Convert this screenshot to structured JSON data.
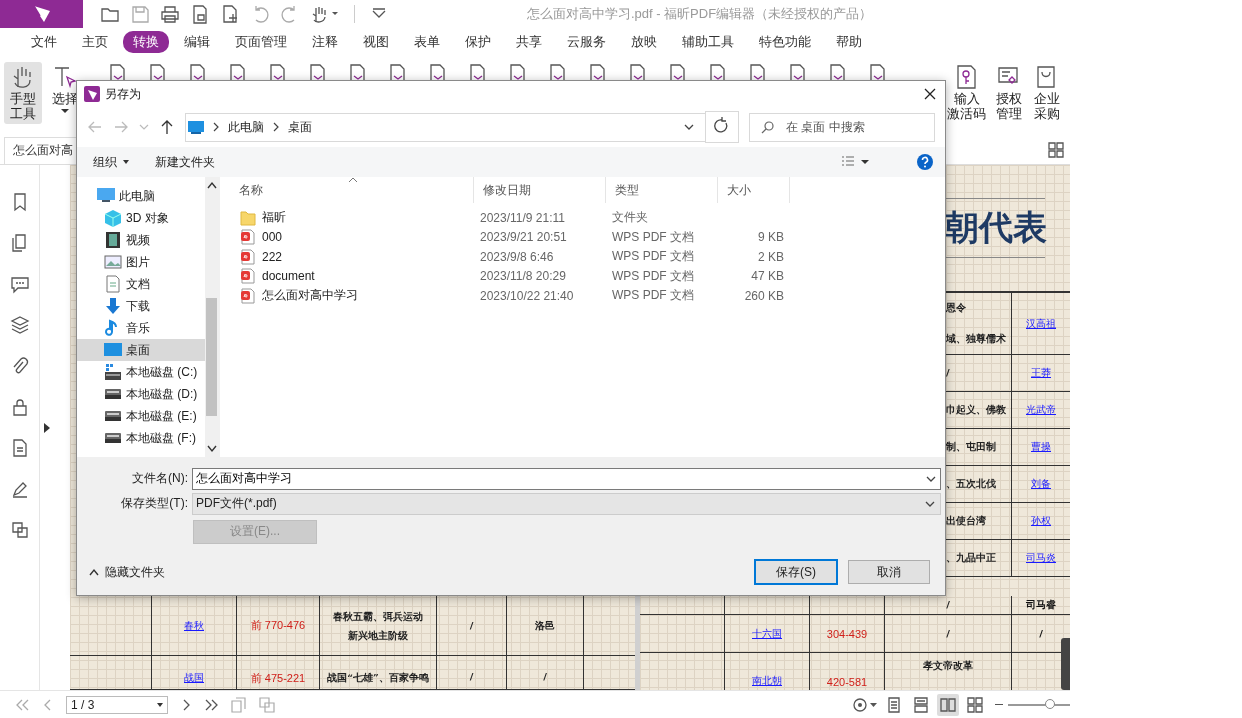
{
  "app": {
    "title": "怎么面对高中学习.pdf - 福昕PDF编辑器（未经授权的产品）"
  },
  "menu": [
    {
      "label": "文件",
      "selected": false
    },
    {
      "label": "主页",
      "selected": false
    },
    {
      "label": "转换",
      "selected": true
    },
    {
      "label": "编辑",
      "selected": false
    },
    {
      "label": "页面管理",
      "selected": false
    },
    {
      "label": "注释",
      "selected": false
    },
    {
      "label": "视图",
      "selected": false
    },
    {
      "label": "表单",
      "selected": false
    },
    {
      "label": "保护",
      "selected": false
    },
    {
      "label": "共享",
      "selected": false
    },
    {
      "label": "云服务",
      "selected": false
    },
    {
      "label": "放映",
      "selected": false
    },
    {
      "label": "辅助工具",
      "selected": false
    },
    {
      "label": "特色功能",
      "selected": false
    },
    {
      "label": "帮助",
      "selected": false
    }
  ],
  "ribbon": {
    "tools_left": [
      {
        "kind": "hand",
        "lines": [
          "手型",
          "工具"
        ],
        "selected": true,
        "menu": false
      },
      {
        "kind": "select",
        "lines": [
          "选择"
        ],
        "selected": false,
        "menu": true
      }
    ],
    "tools_right": [
      {
        "kind": "key",
        "lines": [
          "输入",
          "激活码"
        ]
      },
      {
        "kind": "license",
        "lines": [
          "授权",
          "管理"
        ]
      },
      {
        "kind": "bag",
        "lines": [
          "企业",
          "采购"
        ]
      }
    ]
  },
  "doc_tab": {
    "label": "怎么面对高"
  },
  "document": {
    "title_fragment": "朝代表",
    "strip_rows": [
      {
        "events": [
          "恩令",
          "域、独尊儒术"
        ],
        "ruler": "汉高祖",
        "link": true
      },
      {
        "events": [
          "/"
        ],
        "ruler": "王莽",
        "link": true
      },
      {
        "events": [
          "巾起义、佛教"
        ],
        "ruler": "光武帝",
        "link": true
      },
      {
        "events": [
          "制、屯田制"
        ],
        "ruler": "曹操",
        "link": true
      },
      {
        "events": [
          "、五次北伐"
        ],
        "ruler": "刘备",
        "link": true
      },
      {
        "events": [
          "出使台湾"
        ],
        "ruler": "孙权",
        "link": true
      },
      {
        "events": [
          "、九品中正"
        ],
        "ruler": "司马炎",
        "link": true
      }
    ],
    "left_rows": [
      {
        "name": "春秋",
        "years": "前 770-476",
        "events": [
          "春秋五霸、弭兵运动",
          "新兴地主阶级"
        ],
        "col_4": "/",
        "col_5": "洛邑"
      },
      {
        "name": "战国",
        "years": "前 475-221",
        "events": [
          "战国“七雄”、百家争鸣"
        ],
        "col_4": "/",
        "col_5": "/"
      }
    ],
    "right_rows": [
      {
        "events": [
          "/"
        ],
        "ruler": "司马睿",
        "link": false
      },
      {
        "name": "十六国",
        "years": "304-439",
        "events": [
          "/"
        ],
        "ruler": "/",
        "link": false
      },
      {
        "name": "南北朝",
        "years": "420-581",
        "events": [
          "孝文帝改革"
        ]
      }
    ]
  },
  "dialog": {
    "title": "另存为",
    "path": [
      "此电脑",
      "桌面"
    ],
    "search_placeholder": "在 桌面 中搜索",
    "commands": [
      {
        "label": "组织",
        "menu": true
      },
      {
        "label": "新建文件夹",
        "menu": false
      }
    ],
    "tree": [
      {
        "kind": "pc",
        "label": "此电脑",
        "selected": false,
        "children": [
          {
            "kind": "cube",
            "label": "3D 对象",
            "selected": false
          },
          {
            "kind": "video",
            "label": "视频",
            "selected": false
          },
          {
            "kind": "picture",
            "label": "图片",
            "selected": false
          },
          {
            "kind": "document",
            "label": "文档",
            "selected": false
          },
          {
            "kind": "download",
            "label": "下载",
            "selected": false
          },
          {
            "kind": "music",
            "label": "音乐",
            "selected": false
          },
          {
            "kind": "desktop",
            "label": "桌面",
            "selected": true
          },
          {
            "kind": "system_drive",
            "label": "本地磁盘 (C:)",
            "selected": false
          },
          {
            "kind": "drive",
            "label": "本地磁盘 (D:)",
            "selected": false
          },
          {
            "kind": "drive",
            "label": "本地磁盘 (E:)",
            "selected": false
          },
          {
            "kind": "drive",
            "label": "本地磁盘 (F:)",
            "selected": false
          }
        ]
      }
    ],
    "columns": [
      "名称",
      "修改日期",
      "类型",
      "大小"
    ],
    "files": [
      {
        "kind": "folder",
        "name": "福昕",
        "modified": "2023/11/9 21:11",
        "type": "文件夹"
      },
      {
        "kind": "pdf",
        "name": "000",
        "modified": "2023/9/21 20:51",
        "type": "WPS PDF 文档",
        "size": "9 KB"
      },
      {
        "kind": "pdf",
        "name": "222",
        "modified": "2023/9/8 6:46",
        "type": "WPS PDF 文档",
        "size": "2 KB"
      },
      {
        "kind": "pdf",
        "name": "document",
        "modified": "2023/11/8 20:29",
        "type": "WPS PDF 文档",
        "size": "47 KB"
      },
      {
        "kind": "pdf",
        "name": "怎么面对高中学习",
        "modified": "2023/10/22 21:40",
        "type": "WPS PDF 文档",
        "size": "260 KB"
      }
    ],
    "filename_label": "文件名(N):",
    "filename": "怎么面对高中学习",
    "filetype_label": "保存类型(T):",
    "filetype": "PDF文件(*.pdf)",
    "settings_button": {
      "label": "设置(E)...",
      "disabled": true
    },
    "hide_folders": "隐藏文件夹",
    "buttons": [
      {
        "label": "保存(S)",
        "default": true
      },
      {
        "label": "取消",
        "default": false
      }
    ]
  },
  "status": {
    "page": "1 / 3",
    "view_modes": [
      {
        "kind": "single",
        "selected": false
      },
      {
        "kind": "continuous",
        "selected": false
      },
      {
        "kind": "facing",
        "selected": true
      },
      {
        "kind": "facing_continuous",
        "selected": false
      }
    ],
    "zoom": {
      "level": 0.67
    }
  }
}
